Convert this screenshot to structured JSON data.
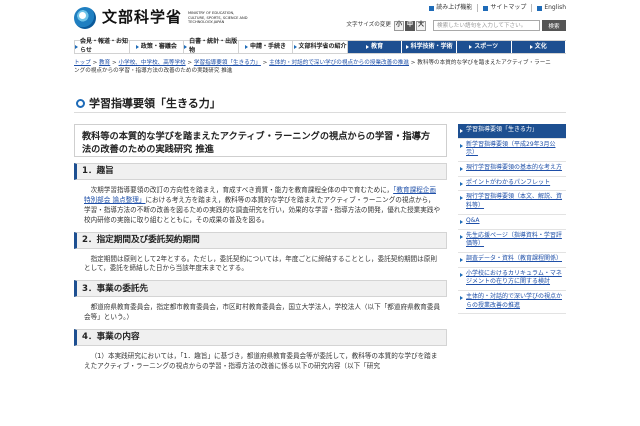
{
  "header": {
    "logo_text": "文部科学省",
    "logo_sub": "MINISTRY OF EDUCATION, CULTURE, SPORTS, SCIENCE AND TECHNOLOGY-JAPAN",
    "util_links": [
      "読み上げ機能",
      "サイトマップ",
      "English"
    ],
    "font_size_label": "文字サイズの変更",
    "font_sizes": [
      "小",
      "中",
      "大"
    ],
    "search": {
      "placeholder": "検索したい語句を入力して下さい。",
      "button_label": "検索"
    }
  },
  "gnav": [
    "会見・報道・お知らせ",
    "政策・審議会",
    "白書・統計・出版物",
    "申請・手続き",
    "文部科学省の紹介",
    "教育",
    "科学技術・学術",
    "スポーツ",
    "文化"
  ],
  "breadcrumb": {
    "line1_links": [
      "トップ",
      "教育",
      "小学校、中学校、高等学校",
      "学習指導要領「生きる力」",
      "主体的・対話的で深い学びの視点からの授業改善の推進"
    ],
    "line1_tail": "教科等の本質的な学びを踏まえたアクティブ・ラーニ",
    "line2": "ングの視点からの学習・指導方法の改善のための実践研究 推進"
  },
  "page_title": "学習指導要領「生きる力」",
  "doc_title": "教科等の本質的な学びを踏まえたアクティブ・ラーニングの視点からの学習・指導方法の改善のための実践研究 推進",
  "sections": {
    "s1": {
      "heading": "1．趣旨",
      "text_a": "次期学習指導要領の改訂の方向性を踏まえ，育成すべき資質・能力を教育課程全体の中で育むために，",
      "link": "「教育課程企画特別部会 論点整理」",
      "text_b": "における考え方を踏まえ，教科等の本質的な学びを踏まえたアクティブ・ラーニングの視点から，学習・指導方法の不断の改善を図るための実践的な調査研究を行い，効果的な学習・指導方法の開発，優れた授業実践や校内研修の実施に取り組むとともに，その成果の普及を図る。"
    },
    "s2": {
      "heading": "2．指定期間及び委託契約期間",
      "text": "指定期間は原則として2年とする。ただし，委託契約については，年度ごとに締結することとし，委託契約期間は原則として，委託を締結した日から当該年度末までとする。"
    },
    "s3": {
      "heading": "3．事業の委託先",
      "text": "都道府県教育委員会，指定都市教育委員会，市区町村教育委員会，国立大学法人，学校法人（以下「都道府県教育委員会等」という。）"
    },
    "s4": {
      "heading": "4．事業の内容",
      "text": "（1）本実践研究においては，「1．趣旨」に基づき，都道府県教育委員会等が委託して，教科等の本質的な学びを踏まえたアクティブ・ラーニングの視点からの学習・指導方法の改善に係る以下の研究内容（以下「研究"
    }
  },
  "side_menu": [
    "学習指導要領「生きる力」",
    "新学習指導要領（平成29年3月公示）",
    "現行学習指導要領の基本的な考え方",
    "ポイントがわかるパンフレット",
    "現行学習指導要領（本文、解説、資料等）",
    "Q&A",
    "先生応援ページ（指導資料・学習評価等）",
    "調査データ・資料（教育課程関係）",
    "小学校におけるカリキュラム・マネジメントの在り方に関する検討",
    "主体的・対話的で深い学びの視点からの授業改善の推進"
  ],
  "colors": {
    "accent": "#1d4f91",
    "link": "#1e4fa8"
  }
}
